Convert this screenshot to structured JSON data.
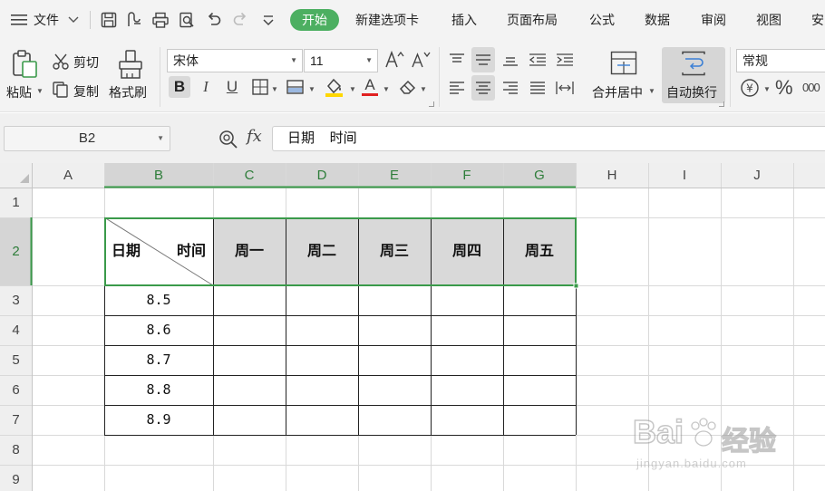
{
  "menubar": {
    "file_label": "文件",
    "tabs": [
      {
        "label": "开始",
        "active": true
      },
      {
        "label": "新建选项卡"
      },
      {
        "label": "插入"
      },
      {
        "label": "页面布局"
      },
      {
        "label": "公式"
      },
      {
        "label": "数据"
      },
      {
        "label": "审阅"
      },
      {
        "label": "视图"
      },
      {
        "label": "安"
      }
    ],
    "active_color": "#4caf61"
  },
  "ribbon": {
    "paste_label": "粘贴",
    "cut_label": "剪切",
    "copy_label": "复制",
    "format_painter_label": "格式刷",
    "font_name": "宋体",
    "font_size": "11",
    "bold": "B",
    "italic": "I",
    "underline": "U",
    "font_color_glyph": "A",
    "merge_center_label": "合并居中",
    "wrap_text_label": "自动换行",
    "number_format": "常规",
    "currency_glyph": "¥",
    "percent_glyph": "%",
    "thousands_glyph": "000",
    "font_color": "#e02020",
    "highlight_color": "#ffd700"
  },
  "formula_bar": {
    "name_box": "B2",
    "fx_label": "fx",
    "value": "日期    时间"
  },
  "sheet": {
    "columns": [
      "A",
      "B",
      "C",
      "D",
      "E",
      "F",
      "G",
      "H",
      "I",
      "J"
    ],
    "rows": [
      "1",
      "2",
      "3",
      "4",
      "5",
      "6",
      "7",
      "8",
      "9"
    ],
    "active_cell": "B2",
    "selection_color": "#3a9a4a",
    "header_fill": "#d9d9d9",
    "b2_left": "日期",
    "b2_right": "时间",
    "weekdays": [
      "周一",
      "周二",
      "周三",
      "周四",
      "周五"
    ],
    "dates": [
      "8.5",
      "8.6",
      "8.7",
      "8.8",
      "8.9"
    ]
  },
  "watermark": {
    "brand": "Bai",
    "brand_cn": "经验",
    "url": "jingyan.baidu.com"
  }
}
